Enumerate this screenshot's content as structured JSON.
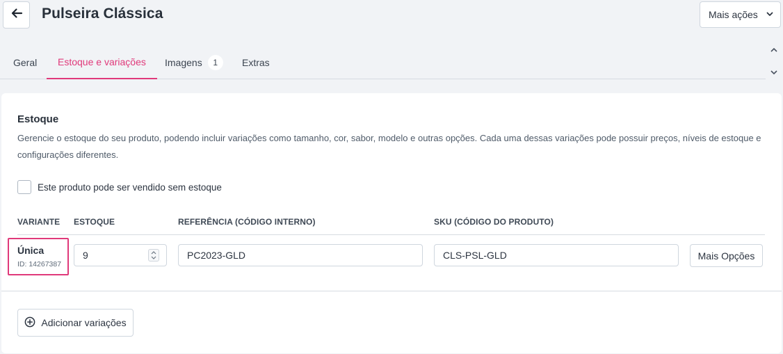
{
  "header": {
    "back_icon": "arrow-left-icon",
    "title": "Pulseira Clássica",
    "more_actions_label": "Mais ações",
    "more_actions_icon": "chevron-down-icon"
  },
  "tabs": [
    {
      "label": "Geral",
      "active": false
    },
    {
      "label": "Estoque e variações",
      "active": true
    },
    {
      "label": "Imagens",
      "badge": "1",
      "active": false
    },
    {
      "label": "Extras",
      "active": false
    }
  ],
  "stock": {
    "title": "Estoque",
    "description": "Gerencie o estoque do seu produto, podendo incluir variações como tamanho, cor, sabor, modelo e outras opções. Cada uma dessas variações pode possuir preços, níveis de estoque e configurações diferentes.",
    "sell_without_stock_label": "Este produto pode ser vendido sem estoque",
    "sell_without_stock_checked": false
  },
  "table": {
    "headers": {
      "variant": "VARIANTE",
      "stock": "ESTOQUE",
      "reference": "REFERÊNCIA (CÓDIGO INTERNO)",
      "sku": "SKU (CÓDIGO DO PRODUTO)"
    },
    "rows": [
      {
        "variant_name": "Única",
        "variant_id": "ID: 14267387",
        "stock": "9",
        "reference": "PC2023-GLD",
        "sku": "CLS-PSL-GLD",
        "more_options_label": "Mais Opções"
      }
    ]
  },
  "add_variations_label": "Adicionar variações",
  "add_variations_icon": "plus-circle-icon",
  "colors": {
    "accent": "#e0397a",
    "background": "#f1f3f6",
    "card": "#ffffff",
    "border": "#cfd6de"
  }
}
